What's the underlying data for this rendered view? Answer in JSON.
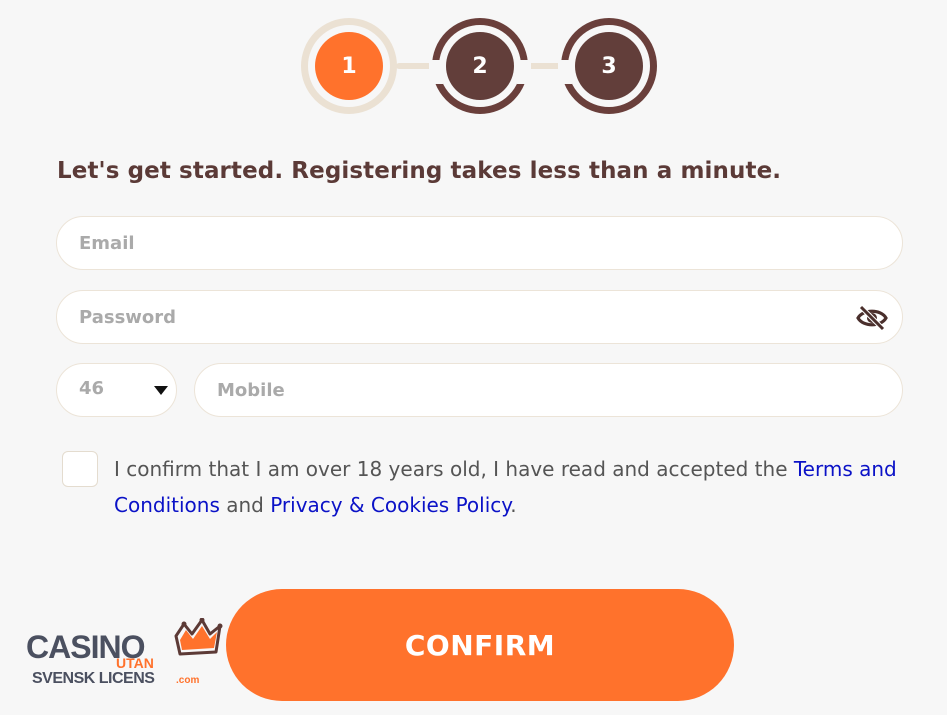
{
  "steps": [
    {
      "label": "1",
      "state": "active"
    },
    {
      "label": "2",
      "state": "pending"
    },
    {
      "label": "3",
      "state": "pending"
    }
  ],
  "form": {
    "heading": "Let's get started. Registering takes less than a minute.",
    "email_placeholder": "Email",
    "password_placeholder": "Password",
    "country_code": "46",
    "mobile_placeholder": "Mobile",
    "consent": {
      "text_before": "I confirm that I am over 18 years old, I have read and accepted the ",
      "terms_link": "Terms and Conditions",
      "text_middle": " and ",
      "privacy_link": "Privacy & Cookies Policy",
      "text_after": "."
    },
    "confirm_label": "CONFIRM"
  },
  "watermark": {
    "line1": "CASINO",
    "line2": "UTAN",
    "line3": "SVENSK LICENS",
    "suffix": ".com"
  },
  "icons": {
    "password_toggle": "eye-slash-icon",
    "country_dropdown": "caret-down-icon",
    "logo_crown": "crown-icon"
  },
  "colors": {
    "accent": "#ff722c",
    "brown": "#623e3a",
    "link": "#0b12c7",
    "step_inactive_ring": "#ebe1d3"
  }
}
